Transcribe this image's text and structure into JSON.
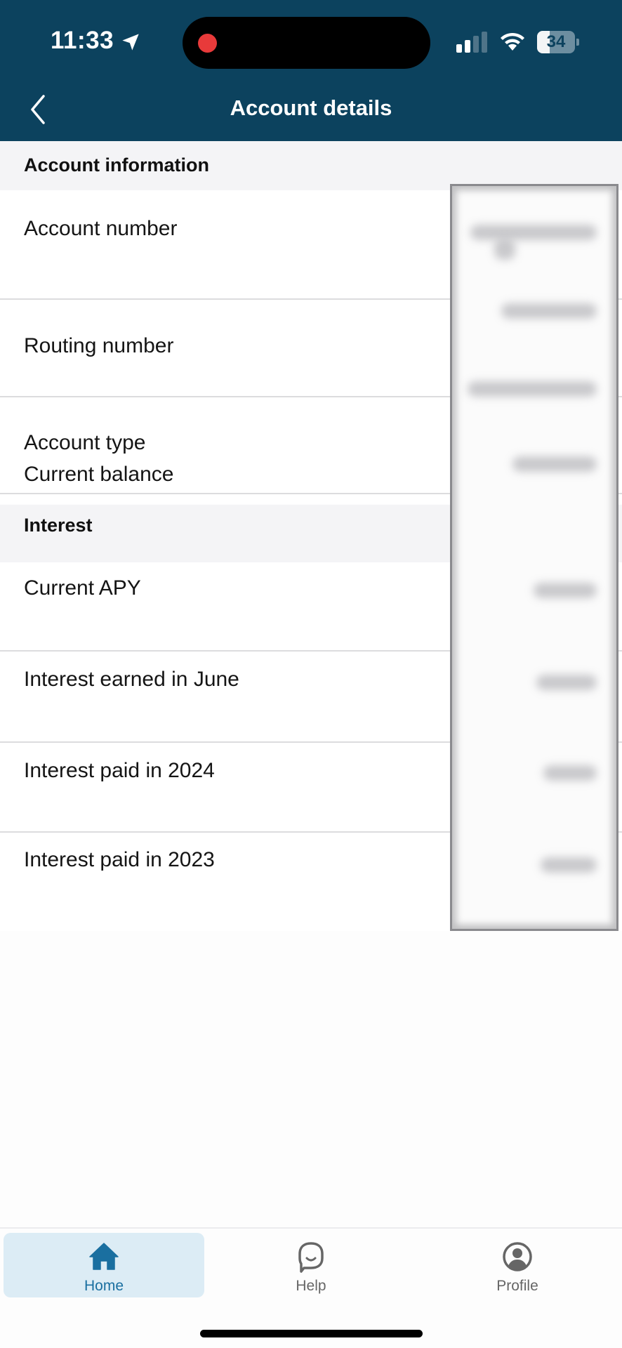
{
  "status_bar": {
    "time": "11:33",
    "location_icon": "location-arrow-icon",
    "recording_indicator": "red-dot",
    "signal_icon": "cellular-signal-icon",
    "wifi_icon": "wifi-icon",
    "battery_percent": "34",
    "battery_level": 0.34
  },
  "header": {
    "title": "Account details",
    "back_icon": "chevron-left-icon"
  },
  "sections": [
    {
      "title": "Account information",
      "rows": [
        {
          "label": "Account number",
          "value": "[redacted]"
        },
        {
          "label": "Routing number",
          "value": "[redacted]"
        },
        {
          "label": "Account type",
          "value": "[redacted]"
        },
        {
          "label": "Current balance",
          "value": "[redacted]"
        }
      ]
    },
    {
      "title": "Interest",
      "rows": [
        {
          "label": "Current APY",
          "value": "[redacted]"
        },
        {
          "label": "Interest earned in June",
          "value": "[redacted]"
        },
        {
          "label": "Interest paid in 2024",
          "value": "[redacted]"
        },
        {
          "label": "Interest paid in 2023",
          "value": "[redacted]"
        }
      ]
    }
  ],
  "tabbar": {
    "tabs": [
      {
        "label": "Home",
        "icon": "home-icon",
        "active": true
      },
      {
        "label": "Help",
        "icon": "chat-bubble-icon",
        "active": false
      },
      {
        "label": "Profile",
        "icon": "user-circle-icon",
        "active": false
      }
    ]
  },
  "colors": {
    "header_bg": "#0c425e",
    "accent": "#1a6fa0",
    "active_tab_bg": "#dcecf5",
    "section_bg": "#f4f4f6"
  }
}
